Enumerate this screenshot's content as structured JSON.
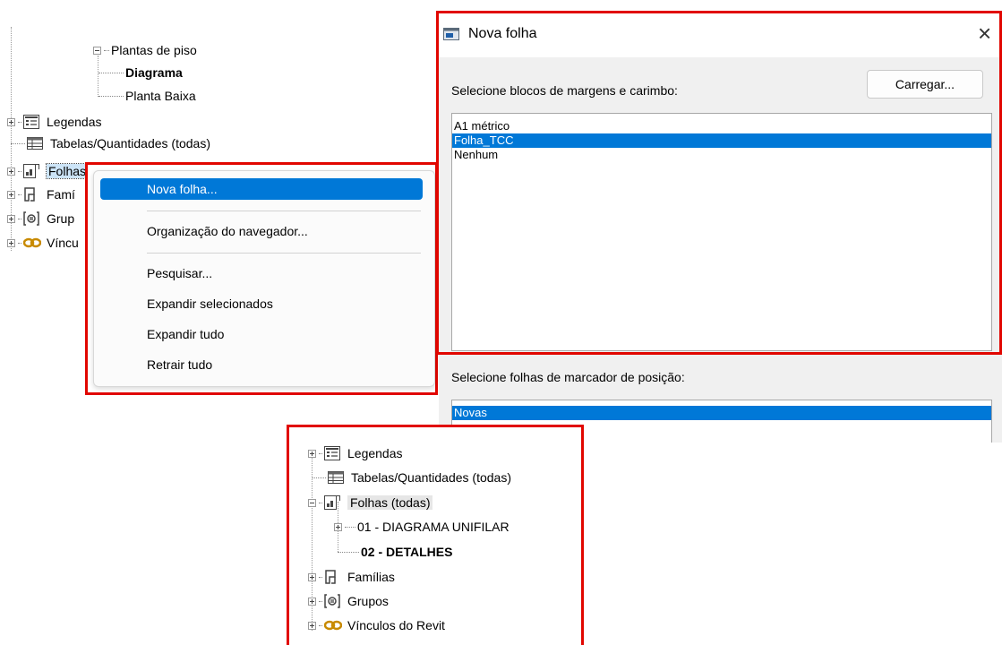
{
  "tree_top": {
    "plantas": "Plantas de piso",
    "diagrama": "Diagrama",
    "planta_baixa": "Planta Baixa",
    "legendas": "Legendas",
    "tabelas": "Tabelas/Quantidades (todas)",
    "folhas": "Folhas (todas)",
    "familias_partial": "Famí",
    "grupos_partial": "Grup",
    "vinculos_partial": "Víncu"
  },
  "context_menu": {
    "items": [
      "Nova folha...",
      "Organização do navegador...",
      "Pesquisar...",
      "Expandir selecionados",
      "Expandir tudo",
      "Retrair tudo"
    ],
    "highlighted_index": 0
  },
  "dialog": {
    "title": "Nova folha",
    "close_glyph": "×",
    "title_block_label": "Selecione blocos de margens e carimbo:",
    "load_button": "Carregar...",
    "title_blocks": [
      "A1 métrico",
      "Folha_TCC",
      "Nenhum"
    ],
    "selected_title_block": "Folha_TCC",
    "placeholder_label": "Selecione folhas de marcador de posição:",
    "placeholder_sheets": [
      "Novas"
    ]
  },
  "tree_bottom": {
    "legendas": "Legendas",
    "tabelas": "Tabelas/Quantidades (todas)",
    "folhas": "Folhas (todas)",
    "sheet1": "01 - DIAGRAMA UNIFILAR",
    "sheet2": "02 - DETALHES",
    "familias": "Famílias",
    "grupos": "Grupos",
    "vinculos": "Vínculos do Revit"
  },
  "colors": {
    "highlight": "#0078d7",
    "annotation_red": "#e10600",
    "menu_hover": "#e5f1fb"
  },
  "icons": [
    "legend-icon",
    "schedule-icon",
    "sheet-icon",
    "family-icon",
    "group-icon",
    "link-icon"
  ]
}
